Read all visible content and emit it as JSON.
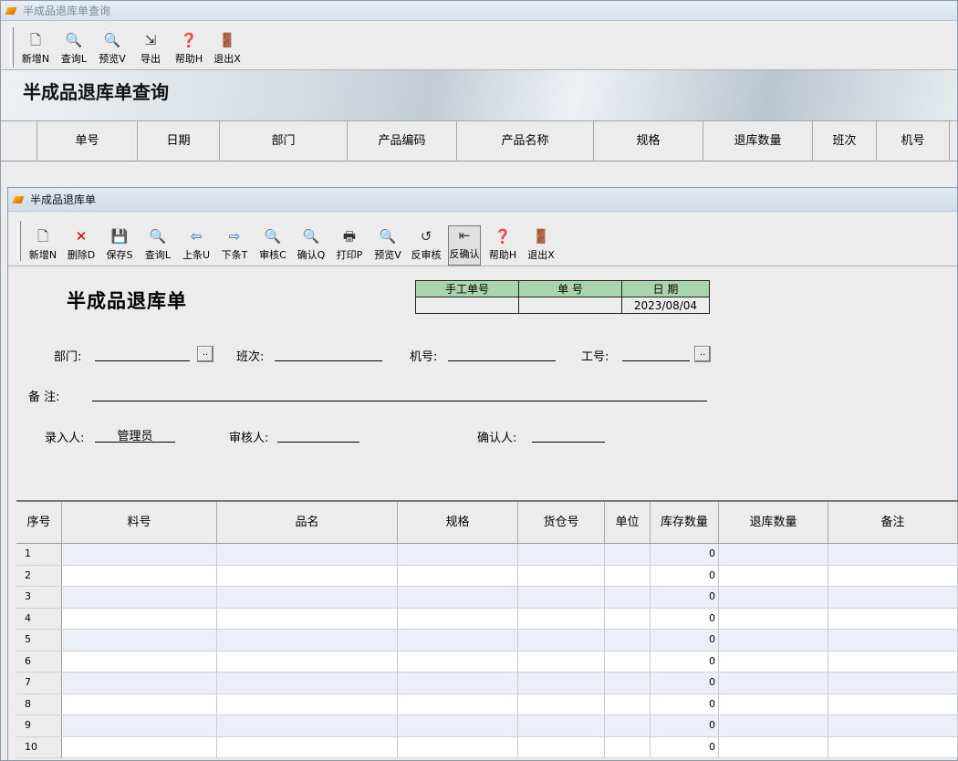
{
  "main_window": {
    "title": "半成品退库单查询",
    "toolbar": [
      {
        "icon": "new-doc-icon",
        "label": "新增N"
      },
      {
        "icon": "query-icon",
        "label": "查询L"
      },
      {
        "icon": "magnifier-icon",
        "label": "预览V"
      },
      {
        "icon": "export-icon",
        "label": "导出"
      },
      {
        "icon": "help-icon",
        "label": "帮助H"
      },
      {
        "icon": "exit-icon",
        "label": "退出X"
      }
    ],
    "banner_title": "半成品退库单查询",
    "columns": [
      "单号",
      "日期",
      "部门",
      "产品编码",
      "产品名称",
      "规格",
      "退库数量",
      "班次",
      "机号"
    ]
  },
  "sub_window": {
    "title": "半成品退库单",
    "toolbar": [
      {
        "icon": "new-doc-icon",
        "label": "新增N"
      },
      {
        "icon": "delete-icon",
        "label": "删除D"
      },
      {
        "icon": "save-icon",
        "label": "保存S"
      },
      {
        "icon": "query-icon",
        "label": "查询L"
      },
      {
        "icon": "arrow-left-icon",
        "label": "上条U"
      },
      {
        "icon": "arrow-right-icon",
        "label": "下条T"
      },
      {
        "icon": "magnifier-icon",
        "label": "审核C"
      },
      {
        "icon": "magnifier-icon",
        "label": "确认Q"
      },
      {
        "icon": "printer-icon",
        "label": "打印P"
      },
      {
        "icon": "magnifier-icon",
        "label": "预览V"
      },
      {
        "icon": "unaudit-icon",
        "label": "反审核"
      },
      {
        "icon": "unconfirm-icon",
        "label": "反确认"
      },
      {
        "icon": "help-icon",
        "label": "帮助H"
      },
      {
        "icon": "exit-icon",
        "label": "退出X"
      }
    ],
    "form_title": "半成品退库单",
    "header_box": {
      "manual_no_label": "手工单号",
      "no_label": "单  号",
      "date_label": "日  期",
      "manual_no": "",
      "no": "",
      "date": "2023/08/04"
    },
    "fields": {
      "dept_label": "部门:",
      "shift_label": "班次:",
      "machine_label": "机号:",
      "worker_label": "工号:",
      "remark_label": "备    注:",
      "entry_label": "录入人:",
      "entry_value": "管理员",
      "auditor_label": "审核人:",
      "confirmer_label": "确认人:"
    },
    "grid": {
      "columns": [
        "序号",
        "料号",
        "品名",
        "规格",
        "货仓号",
        "单位",
        "库存数量",
        "退库数量",
        "备注"
      ],
      "rows": [
        {
          "n": "1",
          "stock": "0"
        },
        {
          "n": "2",
          "stock": "0"
        },
        {
          "n": "3",
          "stock": "0"
        },
        {
          "n": "4",
          "stock": "0"
        },
        {
          "n": "5",
          "stock": "0"
        },
        {
          "n": "6",
          "stock": "0"
        },
        {
          "n": "7",
          "stock": "0"
        },
        {
          "n": "8",
          "stock": "0"
        },
        {
          "n": "9",
          "stock": "0"
        },
        {
          "n": "10",
          "stock": "0"
        }
      ]
    }
  }
}
